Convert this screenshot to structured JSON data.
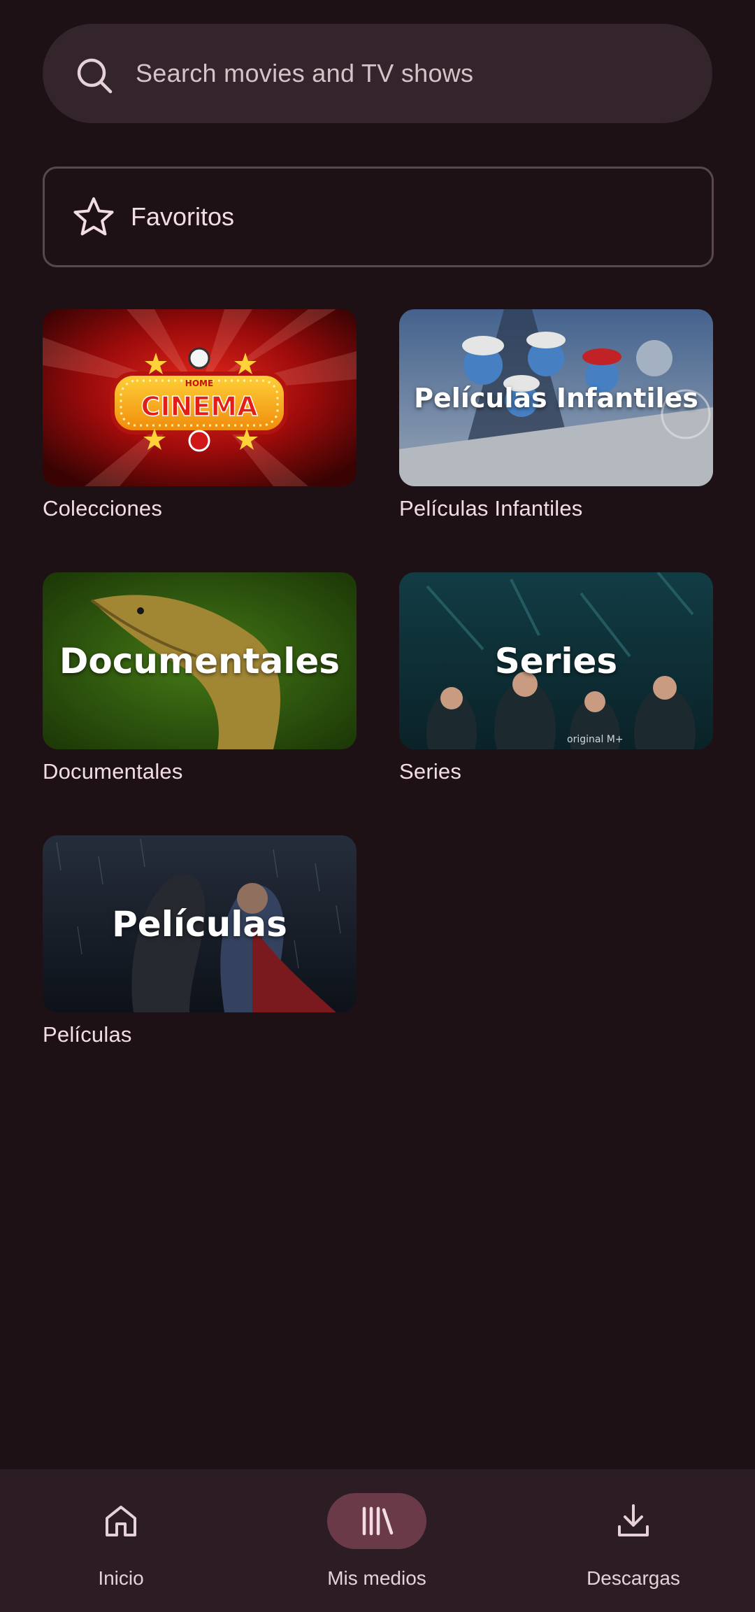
{
  "search": {
    "placeholder": "Search movies and TV shows",
    "icon": "search-icon"
  },
  "favorites": {
    "label": "Favoritos",
    "icon": "star-icon"
  },
  "cards": [
    {
      "label": "Colecciones",
      "overlay": "",
      "artwork": "HOME CINEMA"
    },
    {
      "label": "Películas Infantiles",
      "overlay": "Películas Infantiles"
    },
    {
      "label": "Documentales",
      "overlay": "Documentales"
    },
    {
      "label": "Series",
      "overlay": "Series"
    },
    {
      "label": "Películas",
      "overlay": "Películas"
    }
  ],
  "nav": {
    "items": [
      {
        "label": "Inicio",
        "icon": "home-icon",
        "active": false
      },
      {
        "label": "Mis medios",
        "icon": "library-icon",
        "active": true
      },
      {
        "label": "Descargas",
        "icon": "download-icon",
        "active": false
      }
    ]
  },
  "colors": {
    "background": "#1e1116",
    "surface": "#33252b",
    "nav_background": "#2b1d23",
    "active_pill": "#6a3a48",
    "text": "#f2dde4"
  }
}
